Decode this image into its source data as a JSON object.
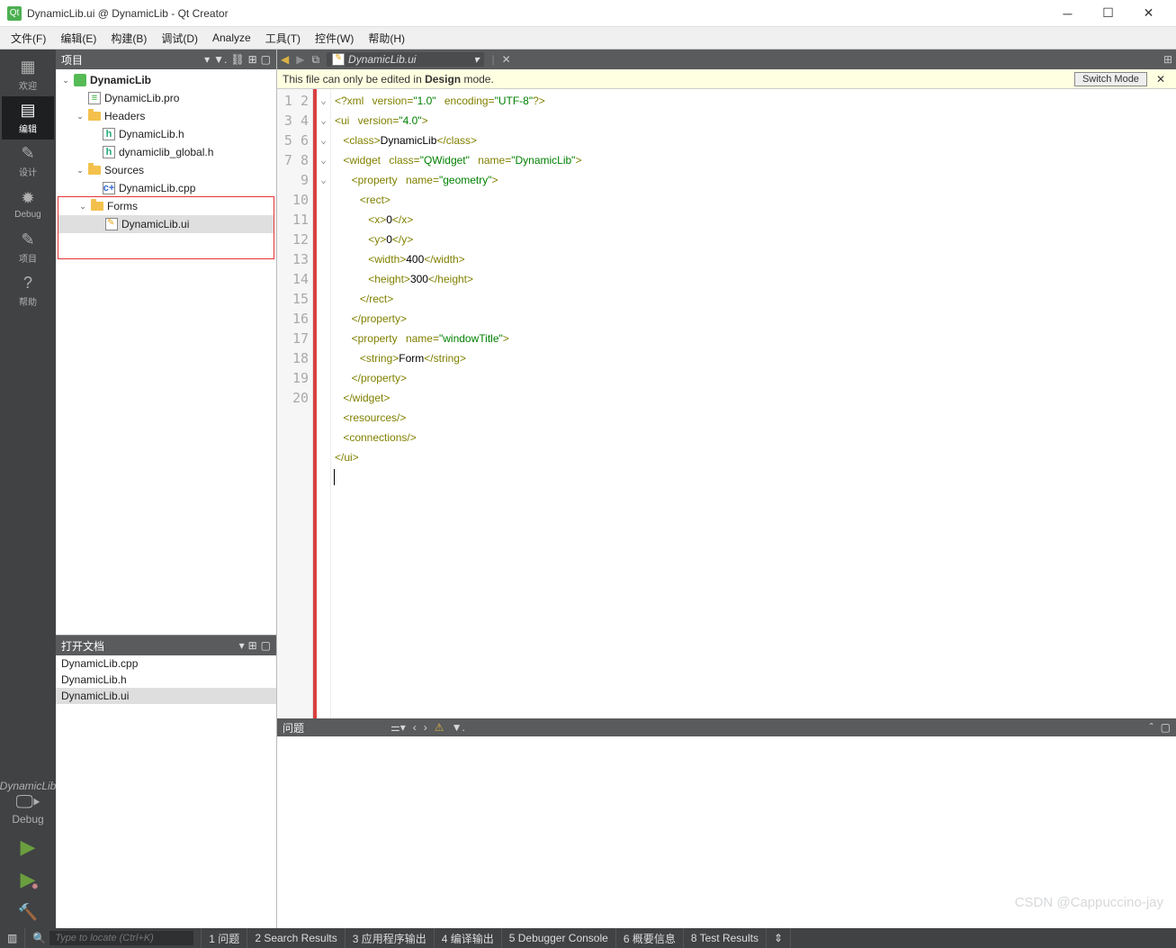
{
  "window": {
    "title": "DynamicLib.ui @ DynamicLib - Qt Creator"
  },
  "menu": {
    "items": [
      "文件(F)",
      "编辑(E)",
      "构建(B)",
      "调试(D)",
      "Analyze",
      "工具(T)",
      "控件(W)",
      "帮助(H)"
    ]
  },
  "modes": {
    "items": [
      {
        "label": "欢迎"
      },
      {
        "label": "编辑"
      },
      {
        "label": "设计"
      },
      {
        "label": "Debug"
      },
      {
        "label": "项目"
      },
      {
        "label": "帮助"
      }
    ],
    "kit": {
      "project": "DynamicLib",
      "config": "Debug"
    }
  },
  "projectPane": {
    "header": "项目",
    "root": "DynamicLib",
    "pro": "DynamicLib.pro",
    "headersLabel": "Headers",
    "headers": [
      "DynamicLib.h",
      "dynamiclib_global.h"
    ],
    "sourcesLabel": "Sources",
    "sources": [
      "DynamicLib.cpp"
    ],
    "formsLabel": "Forms",
    "forms": [
      "DynamicLib.ui"
    ]
  },
  "openDocs": {
    "header": "打开文档",
    "items": [
      "DynamicLib.cpp",
      "DynamicLib.h",
      "DynamicLib.ui"
    ]
  },
  "editor": {
    "file": "DynamicLib.ui",
    "warnPrefix": "This file can only be edited in ",
    "warnBold": "Design",
    "warnSuffix": " mode.",
    "switchBtn": "Switch Mode"
  },
  "issues": {
    "title": "问题"
  },
  "status": {
    "placeholder": "Type to locate (Ctrl+K)",
    "items": [
      "1 问题",
      "2 Search Results",
      "3 应用程序输出",
      "4 编译输出",
      "5 Debugger Console",
      "6 概要信息",
      "8 Test Results"
    ]
  },
  "watermark": "CSDN @Cappuccino-jay",
  "code": {
    "lineCount": 20,
    "folds": {
      "2": "⌄",
      "4": "⌄",
      "5": "⌄",
      "6": "⌄",
      "13": "⌄"
    }
  }
}
